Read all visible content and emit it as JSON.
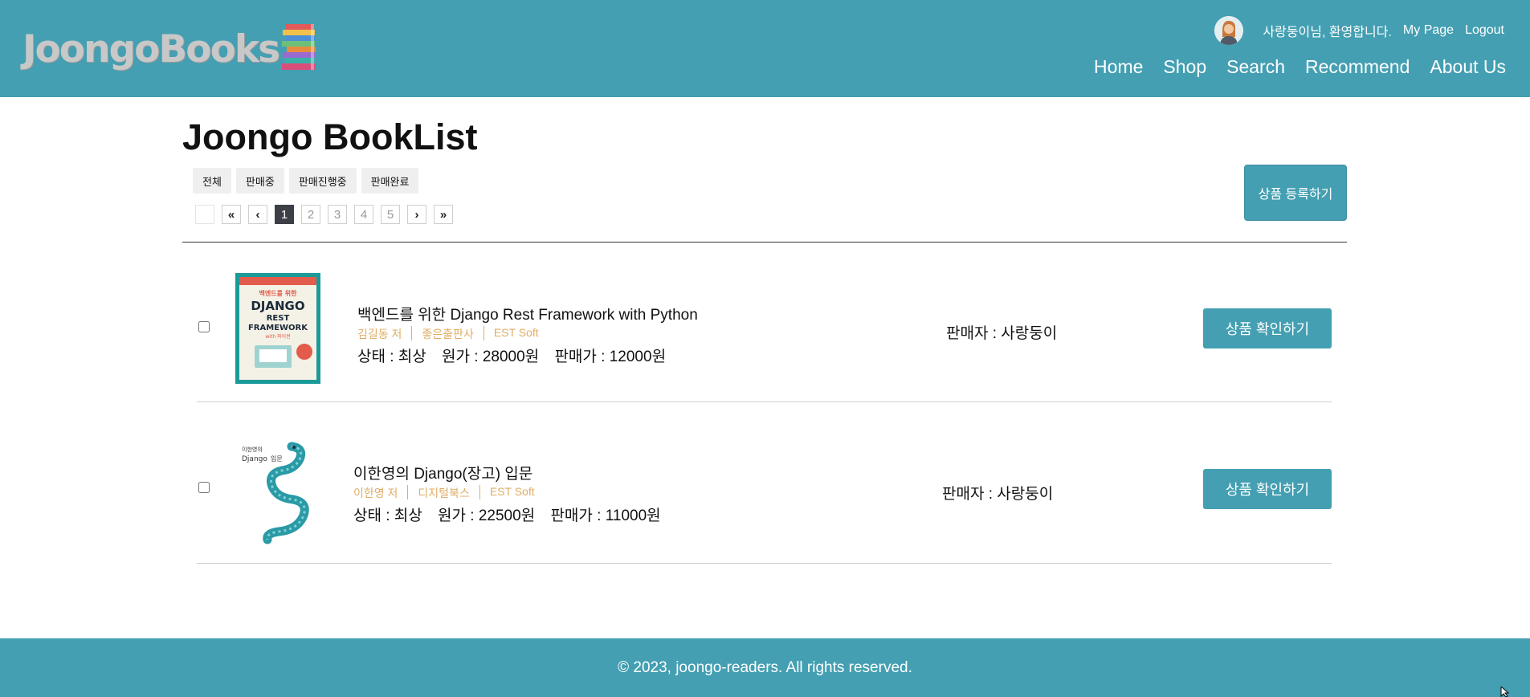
{
  "header": {
    "logo_text": "JoongoBooks",
    "welcome": "사랑둥이님, 환영합니다.",
    "my_page": "My Page",
    "logout": "Logout",
    "nav": [
      "Home",
      "Shop",
      "Search",
      "Recommend",
      "About Us"
    ]
  },
  "main": {
    "title": "Joongo BookList",
    "filters": [
      "전체",
      "판매중",
      "판매진행중",
      "판매완료"
    ],
    "pagination": {
      "first": "«",
      "prev": "‹",
      "pages": [
        "1",
        "2",
        "3",
        "4",
        "5"
      ],
      "current": "1",
      "next": "›",
      "last": "»"
    },
    "register_button": "상품 등록하기",
    "books": [
      {
        "title": "백엔드를 위한 Django Rest Framework with Python",
        "author": "김길동 저",
        "publisher": "좋은출판사",
        "extra": "EST Soft",
        "condition": "상태 : 최상",
        "original_price": "원가 : 28000원",
        "sale_price": "판매가 : 12000원",
        "seller": "판매자 : 사랑둥이",
        "button": "상품 확인하기",
        "cover": {
          "color": "#1a9a98",
          "top_text": "백엔드를 위한",
          "lines": [
            "DJANGO",
            "REST",
            "FRAMEWORK"
          ],
          "subtitle": "with 파이썬"
        }
      },
      {
        "title": "이한영의 Django(장고) 입문",
        "author": "이한영 저",
        "publisher": "디지털북스",
        "extra": "EST Soft",
        "condition": "상태 : 최상",
        "original_price": "원가 : 22500원",
        "sale_price": "판매가 : 11000원",
        "seller": "판매자 : 사랑둥이",
        "button": "상품 확인하기",
        "cover": {
          "color": "#2a9aa6",
          "top_text": "이한영의",
          "lines": [
            "Django"
          ],
          "subtitle": "입문"
        }
      }
    ]
  },
  "footer": {
    "text": "© 2023, joongo-readers. All rights reserved."
  },
  "colors": {
    "brand": "#449fb2",
    "meta_text": "#e0ad66",
    "active_page": "#3c4046"
  }
}
